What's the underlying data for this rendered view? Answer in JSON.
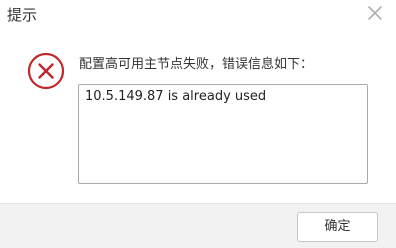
{
  "dialog": {
    "title": "提示",
    "close_icon": "close-icon",
    "status_icon": "error-icon",
    "status_color": "#c0282c",
    "message": "配置高可用主节点失败，错误信息如下：",
    "detail_text": "10.5.149.87 is already used",
    "ok_label": "确定"
  }
}
